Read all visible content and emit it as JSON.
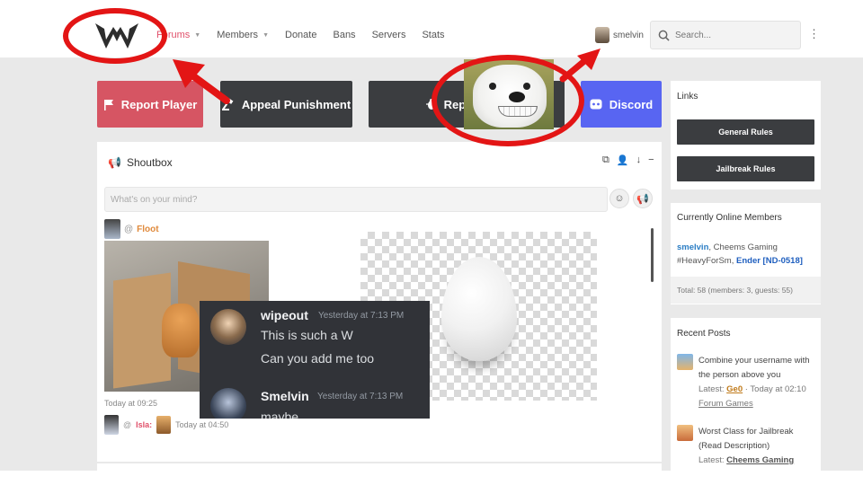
{
  "nav": {
    "items": [
      {
        "label": "Forums",
        "active": true,
        "caret": true
      },
      {
        "label": "Members",
        "active": false,
        "caret": true
      },
      {
        "label": "Donate",
        "active": false,
        "caret": false
      },
      {
        "label": "Bans",
        "active": false,
        "caret": false
      },
      {
        "label": "Servers",
        "active": false,
        "caret": false
      },
      {
        "label": "Stats",
        "active": false,
        "caret": false
      }
    ],
    "username": "smelvin",
    "search_placeholder": "Search..."
  },
  "actions": {
    "report_player": "Report Player",
    "appeal_punishment": "Appeal Punishment",
    "report_bug": "Report Bug",
    "discord": "Discord"
  },
  "shoutbox": {
    "title": "Shoutbox",
    "input_placeholder": "What's on your mind?",
    "messages": [
      {
        "at": "@",
        "author": "Floot",
        "time": "Today at 09:25"
      },
      {
        "at": "@",
        "author": "Isla:",
        "time": "Today at 04:50"
      }
    ]
  },
  "discord_overlay": {
    "messages": [
      {
        "name": "wipeout",
        "time": "Yesterday at 7:13 PM",
        "lines": [
          "This is such a W",
          "Can you add me too"
        ]
      },
      {
        "name": "Smelvin",
        "time": "Yesterday at 7:13 PM",
        "lines": [
          "maybe"
        ]
      }
    ]
  },
  "sidebar": {
    "links": {
      "title": "Links",
      "general_rules": "General Rules",
      "jailbreak_rules": "Jailbreak Rules"
    },
    "online": {
      "title": "Currently Online Members",
      "members": [
        {
          "name": "smelvin",
          "suffix": ","
        },
        {
          "name": "Cheems Gaming",
          "suffix": ""
        },
        {
          "name": "#HeavyForSm",
          "suffix": ","
        },
        {
          "name": "Ender [ND-0518]",
          "suffix": ""
        }
      ],
      "total": "Total: 58 (members: 3, guests: 55)"
    },
    "recent": {
      "title": "Recent Posts",
      "posts": [
        {
          "title": "Combine your username with the person above you",
          "latest_label": "Latest:",
          "latest_user": "Ge0",
          "time": "Today at 02:10",
          "forum": "Forum Games"
        },
        {
          "title": "Worst Class for Jailbreak (Read Description)",
          "latest_label": "Latest:",
          "latest_user": "Cheems Gaming"
        }
      ]
    }
  },
  "colors": {
    "annotation_red": "#e31515",
    "report_red": "#d65563",
    "dark_button": "#3b3d40",
    "discord_blue": "#5865f2",
    "active_nav": "#e0506a"
  }
}
